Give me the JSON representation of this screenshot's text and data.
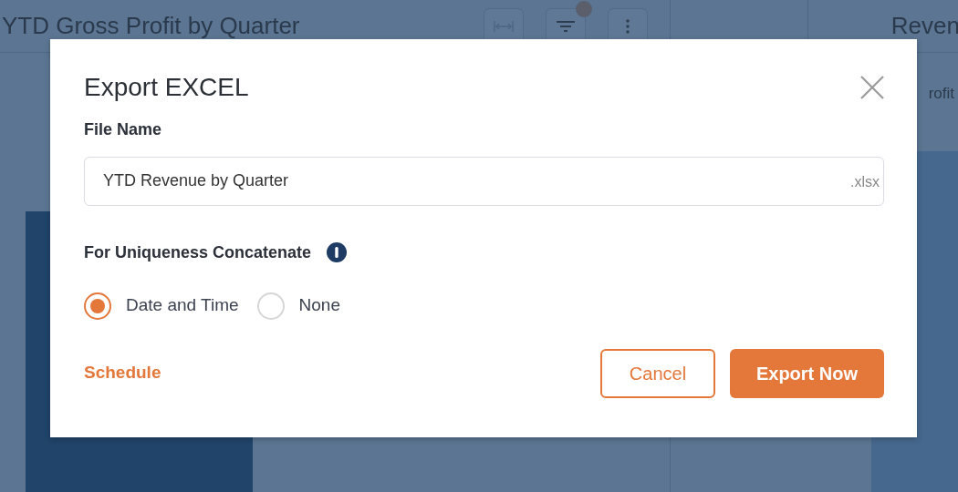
{
  "background": {
    "left_panel": {
      "title": "YTD Gross Profit by Quarter"
    },
    "right_panel": {
      "title": "Reven",
      "subtitle": "rofit"
    }
  },
  "dialog": {
    "title": "Export EXCEL",
    "file_name": {
      "label": "File Name",
      "value": "YTD Revenue by Quarter",
      "suffix": ".xlsx"
    },
    "uniqueness": {
      "label": "For Uniqueness Concatenate",
      "options": [
        {
          "label": "Date and Time",
          "selected": true
        },
        {
          "label": "None",
          "selected": false
        }
      ]
    },
    "schedule_link": "Schedule",
    "buttons": [
      {
        "label": "Cancel",
        "kind": "secondary"
      },
      {
        "label": "Export Now",
        "kind": "primary"
      }
    ]
  }
}
